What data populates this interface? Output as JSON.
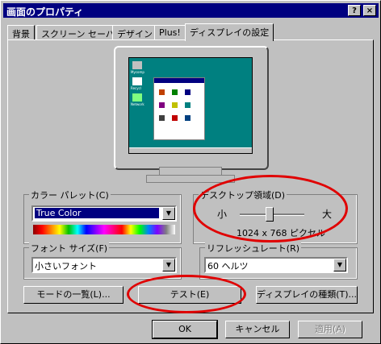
{
  "window": {
    "title": "画面のプロパティ",
    "help_button": "?",
    "close_button": "×"
  },
  "tabs": [
    "背景",
    "スクリーン セーバー",
    "デザイン",
    "Plus!",
    "ディスプレイの設定"
  ],
  "preview": {
    "icons": [
      "Mycomp",
      "Recycl",
      "Network"
    ]
  },
  "color_palette": {
    "label": "カラー パレット(C)",
    "value": "True Color"
  },
  "desktop_area": {
    "label": "デスクトップ領域(D)",
    "min_label": "小",
    "max_label": "大",
    "resolution": "1024 x 768 ピクセル"
  },
  "font_size": {
    "label": "フォント サイズ(F)",
    "value": "小さいフォント"
  },
  "refresh_rate": {
    "label": "リフレッシュレート(R)",
    "value": "60 ヘルツ"
  },
  "buttons": {
    "mode_list": "モードの一覧(L)...",
    "test": "テスト(E)",
    "display_type": "ディスプレイの種類(T)...",
    "ok": "OK",
    "cancel": "キャンセル",
    "apply": "適用(A)"
  },
  "colors": {
    "title_bg": "#000080",
    "desktop": "#008080",
    "highlight_ring": "#e00000"
  }
}
